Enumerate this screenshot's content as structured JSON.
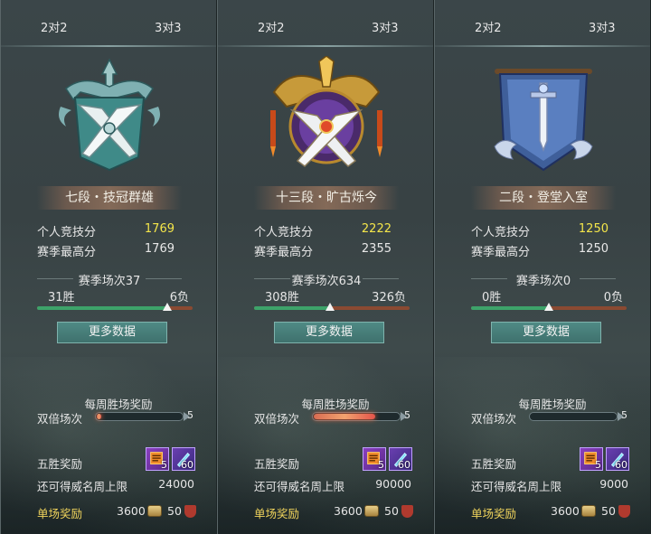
{
  "panels": [
    {
      "tabs": [
        "2对2",
        "3对3"
      ],
      "emblem": "emblem-rank-7-icon",
      "rank_name": "七段・技冠群雄",
      "stats": {
        "personal_label": "个人竞技分",
        "personal_value": "1769",
        "best_label": "赛季最高分",
        "best_value": "1769"
      },
      "season": {
        "title": "赛季场次37",
        "wins": "31胜",
        "losses": "6负",
        "win_ratio": 0.84
      },
      "more_button": "更多数据",
      "weekly": {
        "title": "每周胜场奖励",
        "double_label": "双倍场次",
        "double_count": "5",
        "double_fill": 0.05
      },
      "five_win": {
        "label": "五胜奖励",
        "item1_count": "5",
        "item2_count": "60"
      },
      "cap": {
        "label": "还可得威名周上限",
        "value": "24000"
      },
      "single": {
        "label": "单场奖励",
        "coins": "3600",
        "shields": "50"
      }
    },
    {
      "tabs": [
        "2对2",
        "3对3"
      ],
      "emblem": "emblem-rank-13-icon",
      "rank_name": "十三段・旷古烁今",
      "stats": {
        "personal_label": "个人竞技分",
        "personal_value": "2222",
        "best_label": "赛季最高分",
        "best_value": "2355"
      },
      "season": {
        "title": "赛季场次634",
        "wins": "308胜",
        "losses": "326负",
        "win_ratio": 0.49
      },
      "more_button": "更多数据",
      "weekly": {
        "title": "每周胜场奖励",
        "double_label": "双倍场次",
        "double_count": "5",
        "double_fill": 0.72
      },
      "five_win": {
        "label": "五胜奖励",
        "item1_count": "5",
        "item2_count": "60"
      },
      "cap": {
        "label": "还可得威名周上限",
        "value": "90000"
      },
      "single": {
        "label": "单场奖励",
        "coins": "3600",
        "shields": "50"
      }
    },
    {
      "tabs": [
        "2对2",
        "3对3"
      ],
      "emblem": "emblem-rank-2-icon",
      "rank_name": "二段・登堂入室",
      "stats": {
        "personal_label": "个人竞技分",
        "personal_value": "1250",
        "best_label": "赛季最高分",
        "best_value": "1250"
      },
      "season": {
        "title": "赛季场次0",
        "wins": "0胜",
        "losses": "0负",
        "win_ratio": 0.5
      },
      "more_button": "更多数据",
      "weekly": {
        "title": "每周胜场奖励",
        "double_label": "双倍场次",
        "double_count": "5",
        "double_fill": 0.0
      },
      "five_win": {
        "label": "五胜奖励",
        "item1_count": "5",
        "item2_count": "60"
      },
      "cap": {
        "label": "还可得威名周上限",
        "value": "9000"
      },
      "single": {
        "label": "单场奖励",
        "coins": "3600",
        "shields": "50"
      }
    }
  ],
  "colors": {
    "highlight": "#f4e64a",
    "win_bar": "#3da36a",
    "loss_bar": "#8a4a32",
    "button": "#3f716d",
    "single_label": "#f0d45c"
  }
}
